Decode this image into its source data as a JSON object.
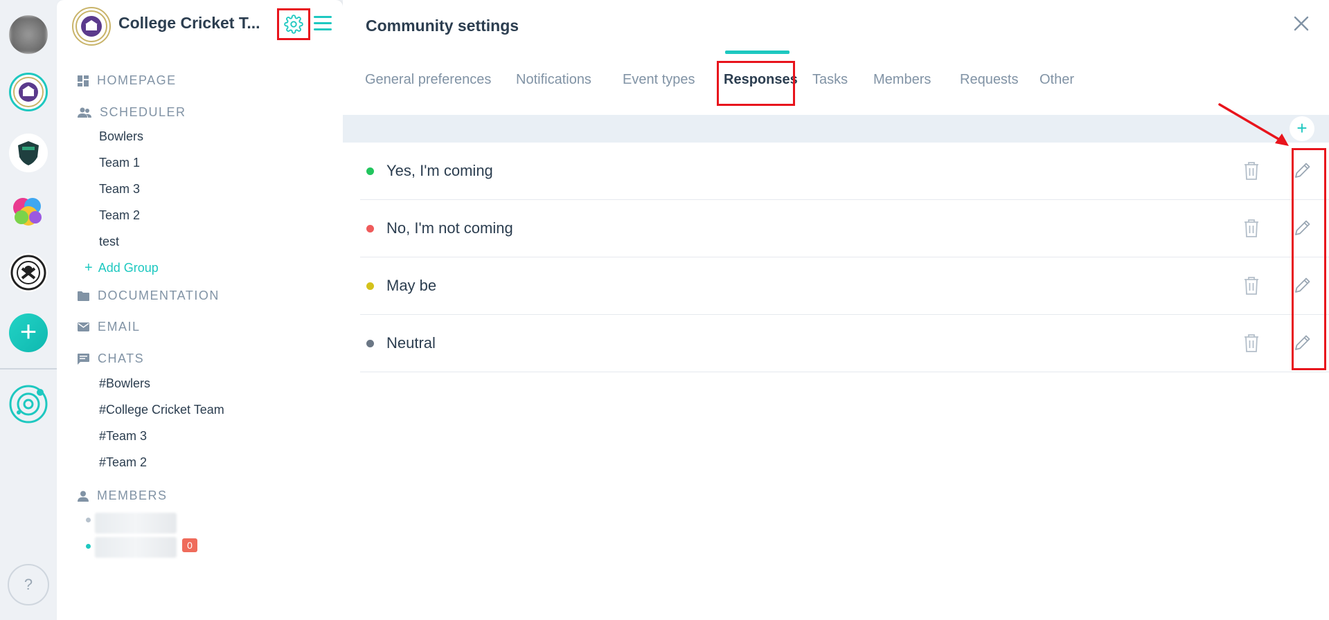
{
  "community": {
    "name": "College Cricket T..."
  },
  "sidebar": {
    "homepage": "HOMEPAGE",
    "scheduler": "SCHEDULER",
    "groups": [
      "Bowlers",
      "Team 1",
      "Team 3",
      "Team 2",
      "test"
    ],
    "add_group": "Add Group",
    "documentation": "DOCUMENTATION",
    "email": "EMAIL",
    "chats_label": "CHATS",
    "chats": [
      "#Bowlers",
      "#College Cricket Team",
      "#Team 3",
      "#Team 2"
    ],
    "members_label": "MEMBERS",
    "unread_badge": "0"
  },
  "rail": {
    "help": "?"
  },
  "main": {
    "title": "Community settings",
    "tabs": [
      "General preferences",
      "Notifications",
      "Event types",
      "Responses",
      "Tasks",
      "Members",
      "Requests",
      "Other"
    ],
    "active_tab": "Responses",
    "add_button": "+",
    "responses": [
      {
        "label": "Yes, I'm coming",
        "color": "#22c55e"
      },
      {
        "label": "No, I'm not coming",
        "color": "#ef5b5b"
      },
      {
        "label": "May be",
        "color": "#d4c21b"
      },
      {
        "label": "Neutral",
        "color": "#6b7785"
      }
    ]
  },
  "colors": {
    "accent": "#1ec8c0",
    "highlight": "#e8141c",
    "muted": "#8193a5"
  }
}
